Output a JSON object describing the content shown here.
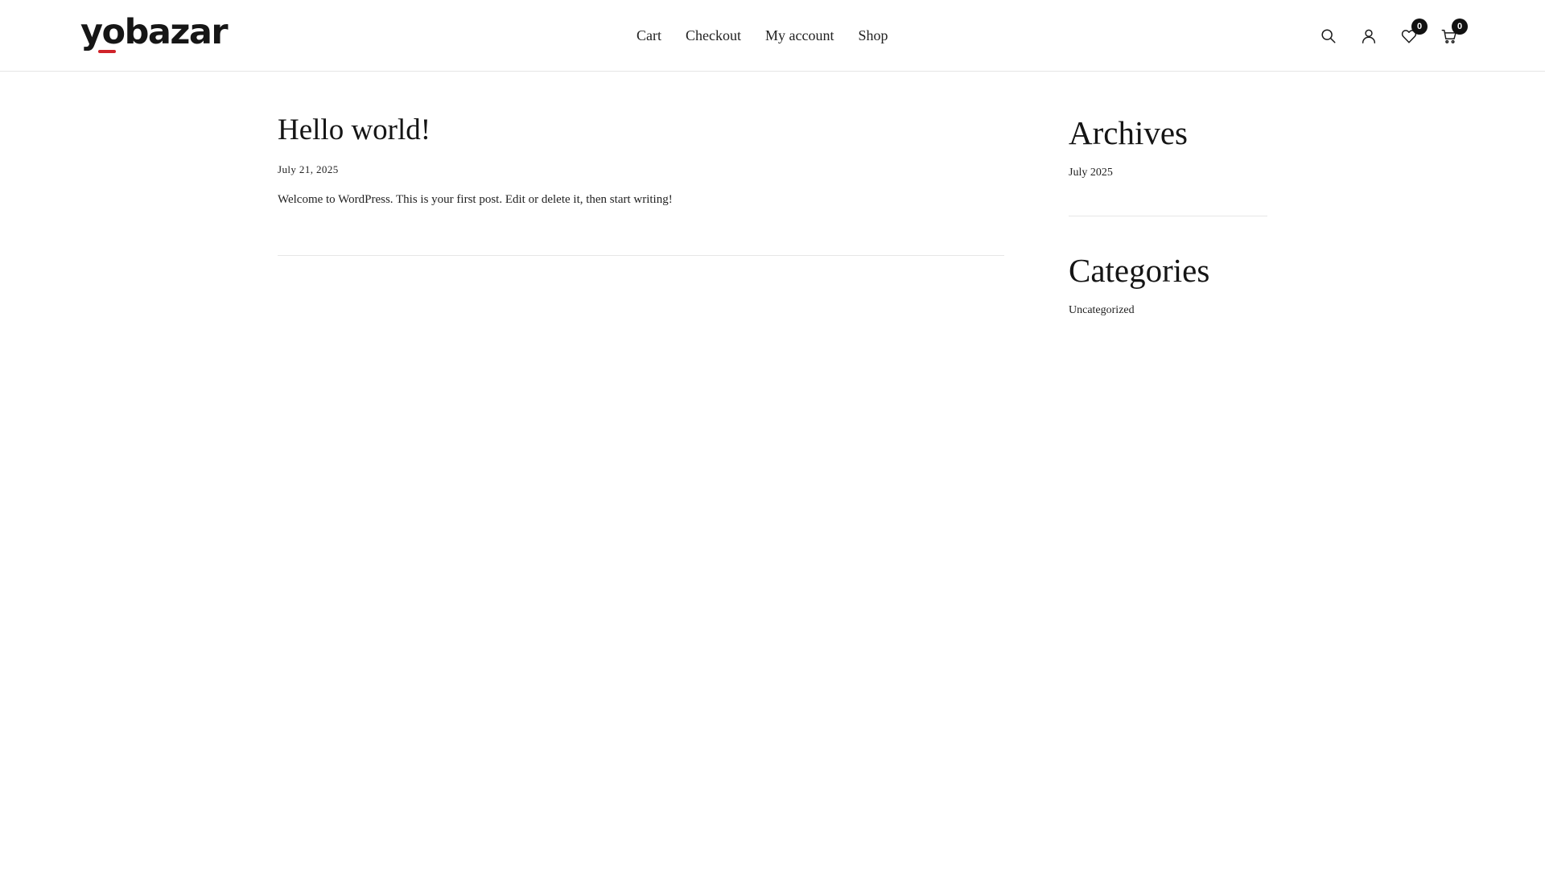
{
  "site": {
    "logo_text": "yobazar",
    "accent_color": "#d0232a"
  },
  "nav": {
    "items": [
      {
        "label": "Cart"
      },
      {
        "label": "Checkout"
      },
      {
        "label": "My account"
      },
      {
        "label": "Shop"
      }
    ]
  },
  "header_icons": {
    "search": {
      "icon": "search-icon"
    },
    "account": {
      "icon": "user-icon"
    },
    "wishlist": {
      "icon": "heart-icon",
      "count": "0"
    },
    "cart": {
      "icon": "cart-icon",
      "count": "0"
    }
  },
  "post": {
    "title": "Hello world!",
    "date": "July 21, 2025",
    "excerpt": "Welcome to WordPress. This is your first post. Edit or delete it, then start writing!"
  },
  "sidebar": {
    "archives": {
      "title": "Archives",
      "items": [
        {
          "label": "July 2025"
        }
      ]
    },
    "categories": {
      "title": "Categories",
      "items": [
        {
          "label": "Uncategorized"
        }
      ]
    }
  }
}
